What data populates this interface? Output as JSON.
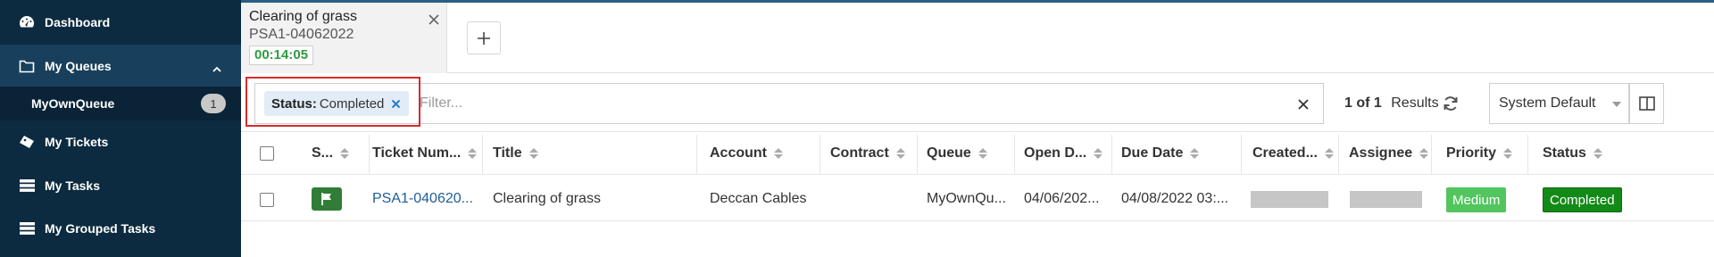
{
  "colors": {
    "sidebar_bg": "#0d2b40",
    "sidebar_active": "#18405c",
    "timer_green": "#2e9b3e",
    "highlight_red": "#d62b2b",
    "priority_medium": "#52c55f",
    "status_completed": "#138a17",
    "flag_green": "#2f7d36",
    "link_blue": "#1f5d99"
  },
  "sidebar": {
    "items": [
      {
        "label": "Dashboard",
        "icon": "dashboard-icon"
      },
      {
        "label": "My Queues",
        "icon": "folder-icon",
        "expanded": true
      },
      {
        "label": "My Tickets",
        "icon": "tickets-icon"
      },
      {
        "label": "My Tasks",
        "icon": "tasks-icon"
      },
      {
        "label": "My Grouped Tasks",
        "icon": "grouped-tasks-icon"
      }
    ],
    "sub_item": {
      "label": "MyOwnQueue",
      "count": "1"
    }
  },
  "tab": {
    "title": "Clearing of grass",
    "id": "PSA1-04062022",
    "timer": "00:14:05"
  },
  "filter": {
    "chip_key": "Status:",
    "chip_value": "Completed",
    "placeholder": "Filter..."
  },
  "results": {
    "range": "1 of 1",
    "label": "Results"
  },
  "view_select": {
    "value": "System Default"
  },
  "table": {
    "headers": [
      "S...",
      "Ticket Num...",
      "Title",
      "Account",
      "Contract",
      "Queue",
      "Open D...",
      "Due Date",
      "Created...",
      "Assignee",
      "Priority",
      "Status"
    ],
    "rows": [
      {
        "ticket_number": "PSA1-040620...",
        "title": "Clearing of grass",
        "account": "Deccan Cables",
        "contract": "",
        "queue": "MyOwnQu...",
        "open_date": "04/06/202...",
        "due_date": "04/08/2022 03:...",
        "priority": "Medium",
        "status": "Completed"
      }
    ]
  }
}
